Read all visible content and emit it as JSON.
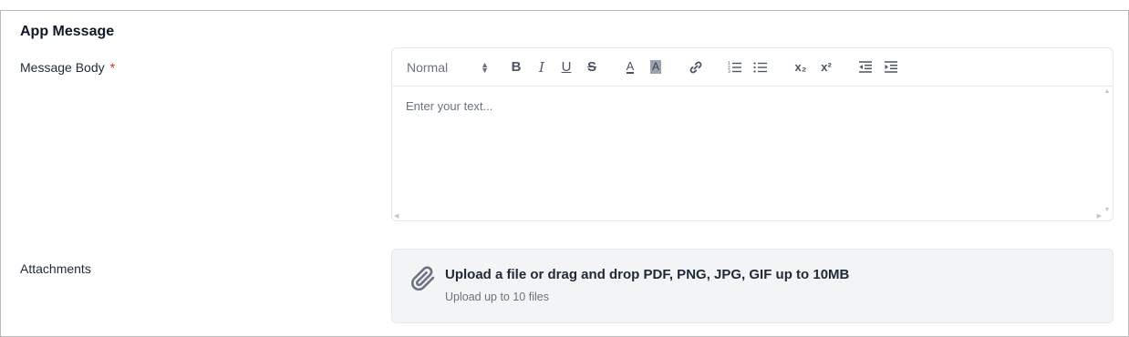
{
  "section": {
    "title": "App Message"
  },
  "fields": {
    "message_body": {
      "label": "Message Body",
      "required_mark": "*"
    },
    "attachments": {
      "label": "Attachments"
    }
  },
  "editor": {
    "format_select": {
      "value": "Normal",
      "arrows_icon": "up-down-arrows-icon"
    },
    "toolbar_buttons": [
      {
        "name": "bold",
        "glyph": "B"
      },
      {
        "name": "italic",
        "glyph": "I"
      },
      {
        "name": "underline",
        "glyph": "U"
      },
      {
        "name": "strike",
        "glyph": "S"
      },
      {
        "name": "text-color",
        "glyph": "A"
      },
      {
        "name": "background-color",
        "glyph": "A"
      },
      {
        "name": "link",
        "icon": "link-icon"
      },
      {
        "name": "ordered-list",
        "icon": "ordered-list-icon"
      },
      {
        "name": "bullet-list",
        "icon": "bullet-list-icon"
      },
      {
        "name": "subscript",
        "glyph": "x₂"
      },
      {
        "name": "superscript",
        "glyph": "x²"
      },
      {
        "name": "outdent",
        "icon": "outdent-icon"
      },
      {
        "name": "indent",
        "icon": "indent-icon"
      }
    ],
    "placeholder": "Enter your text..."
  },
  "upload": {
    "title": "Upload a file or drag and drop PDF, PNG, JPG, GIF up to 10MB",
    "subtitle": "Upload up to 10 files",
    "icon": "paperclip-icon"
  },
  "colors": {
    "required": "#dc2626",
    "dropzone_bg": "#f3f4f6",
    "border": "#e5e7eb",
    "text_primary": "#111827",
    "text_muted": "#6b7280"
  }
}
